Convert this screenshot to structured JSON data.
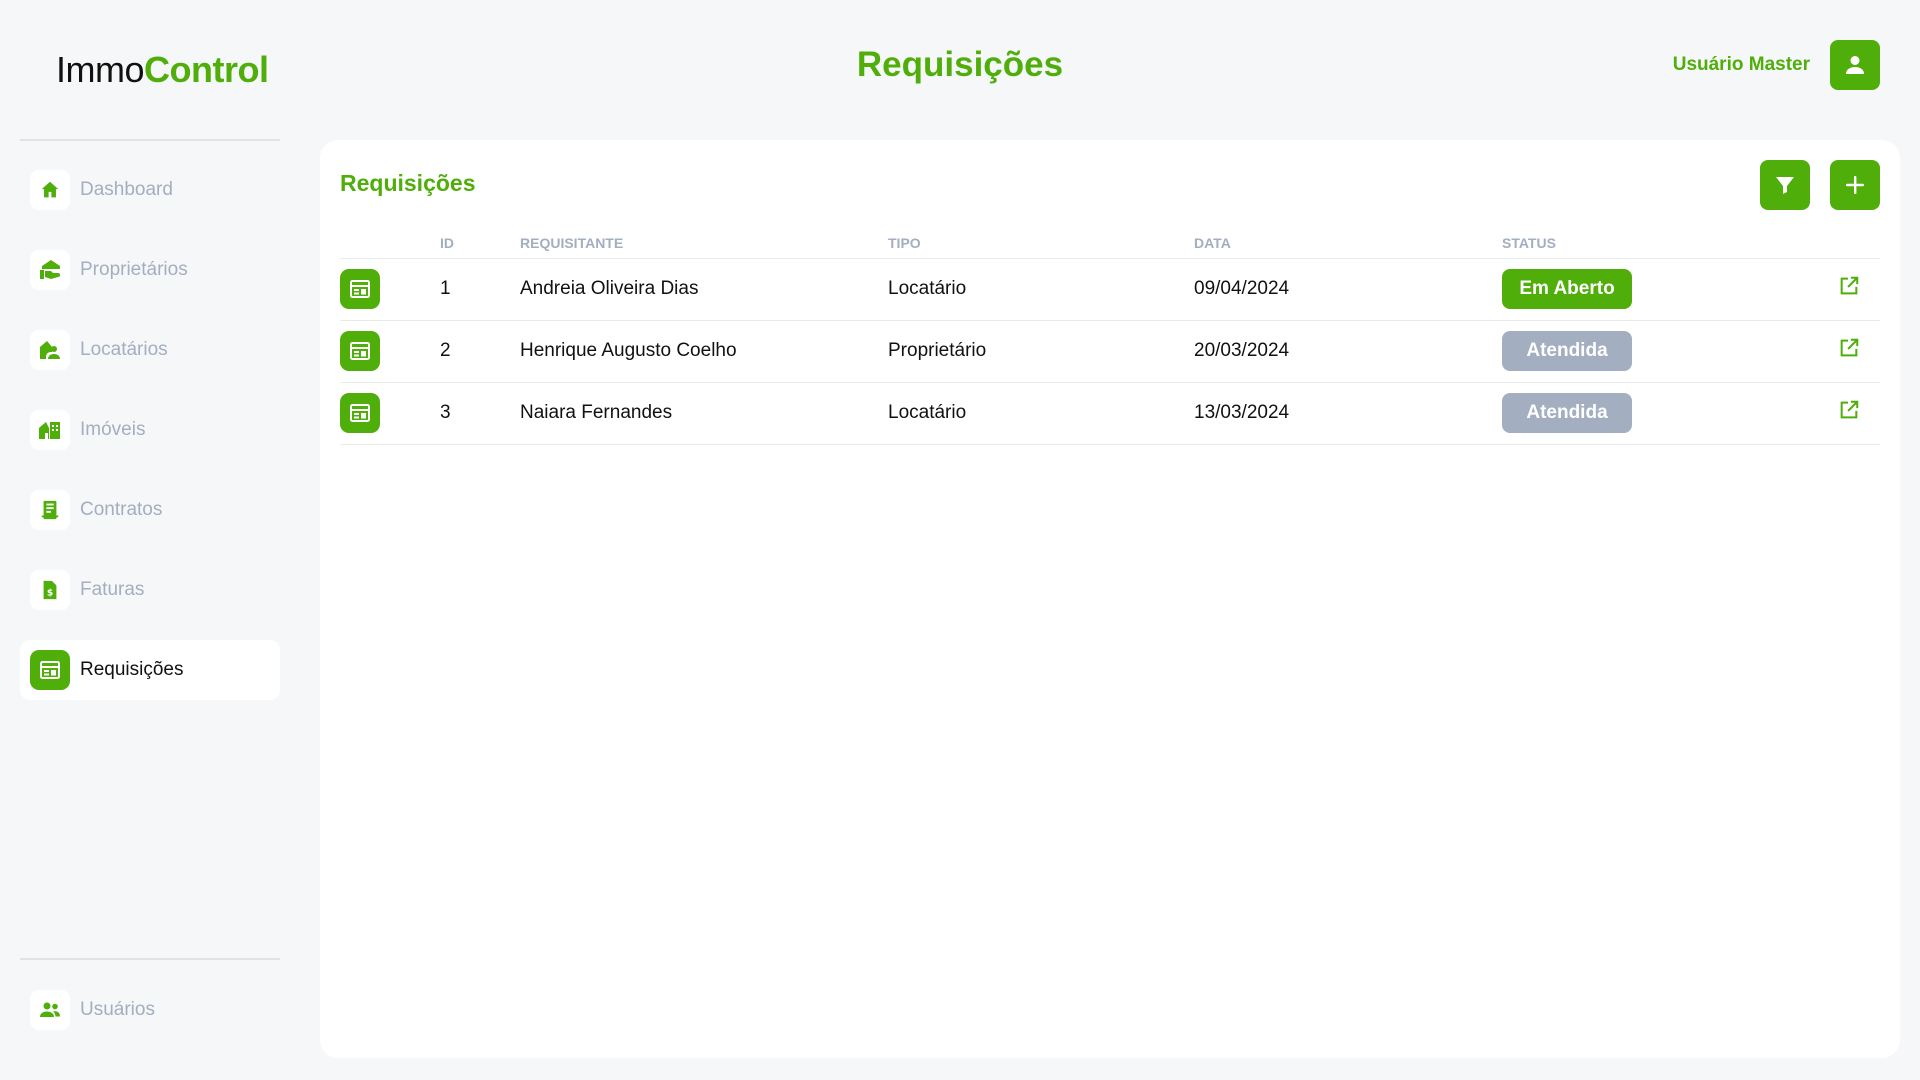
{
  "header": {
    "logo_part1": "Immo",
    "logo_part2": "Control",
    "page_title": "Requisições",
    "user_name": "Usuário Master",
    "user_icon": "user-icon"
  },
  "colors": {
    "accent": "#4fae0a",
    "muted": "#a3aec0",
    "background": "#f6f7f9",
    "card": "#ffffff"
  },
  "sidebar": {
    "items": [
      {
        "label": "Dashboard",
        "icon": "home-icon",
        "active": false
      },
      {
        "label": "Proprietários",
        "icon": "owner-icon",
        "active": false
      },
      {
        "label": "Locatários",
        "icon": "tenant-icon",
        "active": false
      },
      {
        "label": "Imóveis",
        "icon": "property-icon",
        "active": false
      },
      {
        "label": "Contratos",
        "icon": "contract-icon",
        "active": false
      },
      {
        "label": "Faturas",
        "icon": "invoice-icon",
        "active": false
      },
      {
        "label": "Requisições",
        "icon": "request-icon",
        "active": true
      }
    ],
    "bottom_item": {
      "label": "Usuários",
      "icon": "users-icon",
      "active": false
    }
  },
  "main": {
    "title": "Requisições",
    "filter_icon": "filter-icon",
    "add_icon": "plus-icon",
    "columns": [
      "ID",
      "REQUISITANTE",
      "TIPO",
      "DATA",
      "STATUS"
    ],
    "rows": [
      {
        "id": "1",
        "requisitante": "Andreia Oliveira Dias",
        "tipo": "Locatário",
        "data": "09/04/2024",
        "status": "Em Aberto",
        "status_kind": "open"
      },
      {
        "id": "2",
        "requisitante": "Henrique Augusto Coelho",
        "tipo": "Proprietário",
        "data": "20/03/2024",
        "status": "Atendida",
        "status_kind": "done"
      },
      {
        "id": "3",
        "requisitante": "Naiara Fernandes",
        "tipo": "Locatário",
        "data": "13/03/2024",
        "status": "Atendida",
        "status_kind": "done"
      }
    ]
  }
}
